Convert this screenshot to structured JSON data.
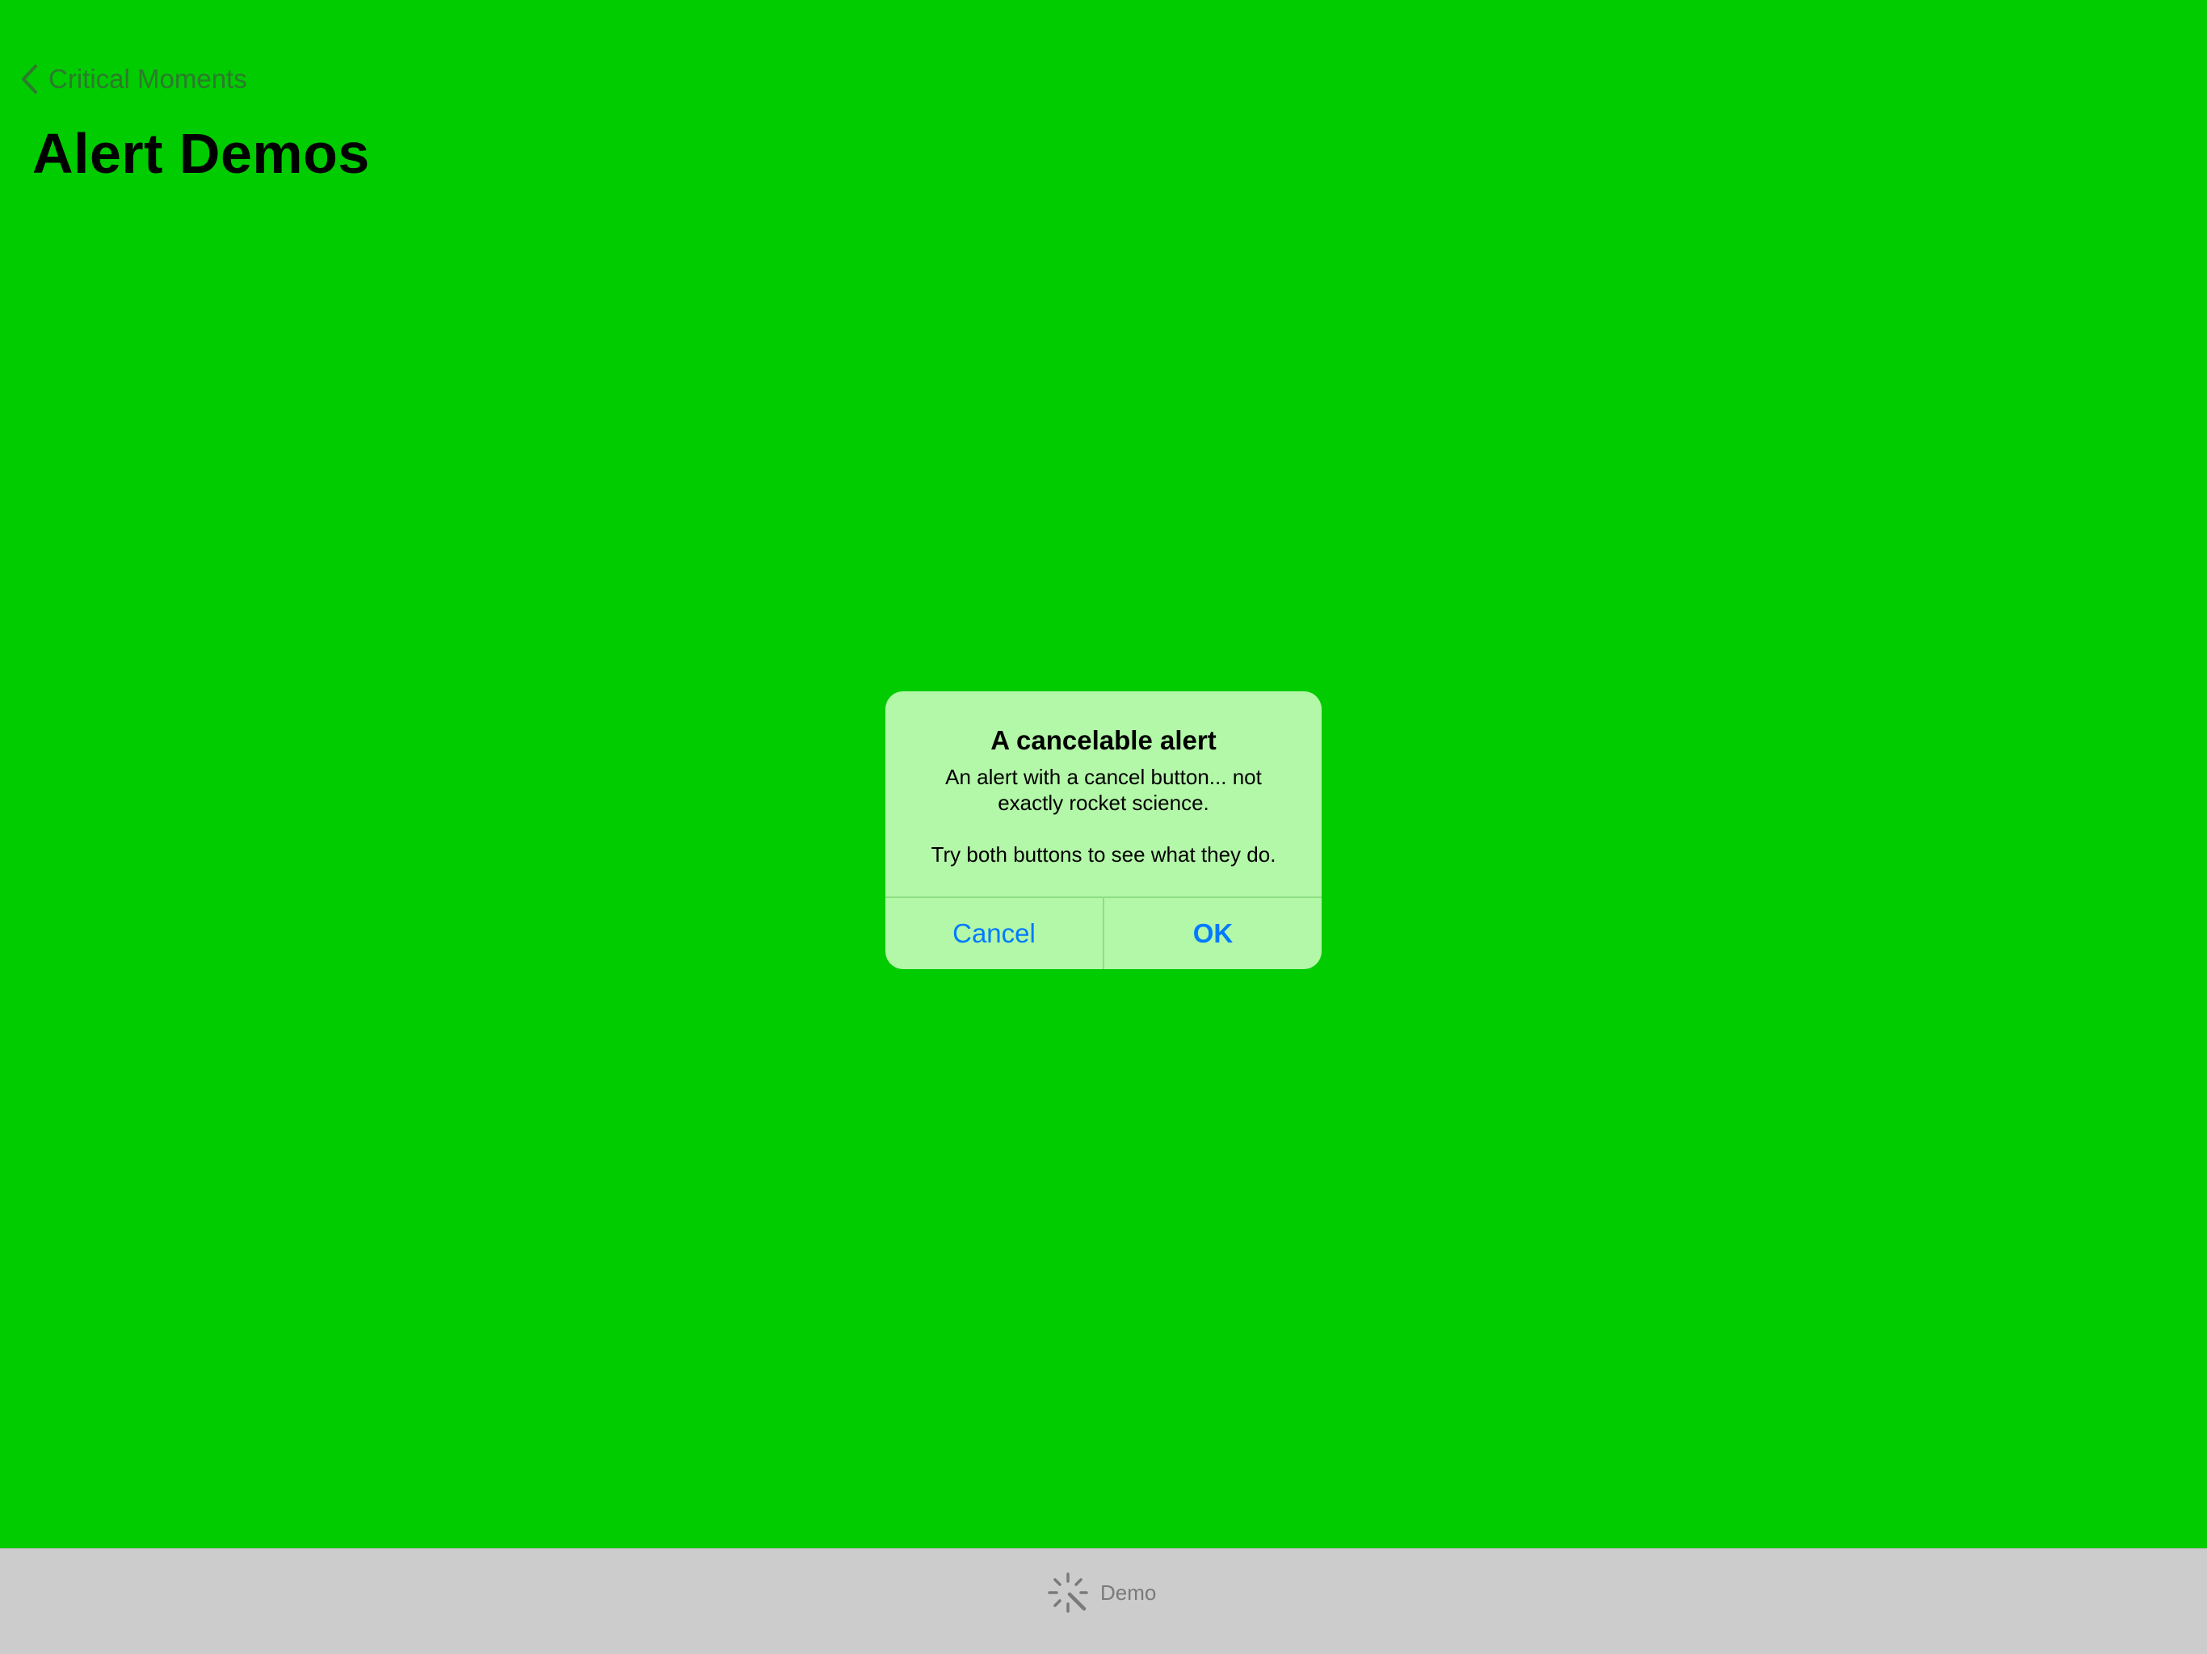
{
  "nav": {
    "back_label": "Critical Moments",
    "back_icon": "chevron-left-icon"
  },
  "page": {
    "title": "Alert Demos"
  },
  "alert": {
    "title": "A cancelable alert",
    "message": "An alert with a cancel button... not\nexactly rocket science.\n\nTry both buttons to see what they do.",
    "cancel_label": "Cancel",
    "ok_label": "OK"
  },
  "tabbar": {
    "items": [
      {
        "label": "Demo",
        "icon": "magic-wand-icon"
      }
    ]
  },
  "colors": {
    "background": "#00cc00",
    "alert_background": "#b3f7a8",
    "button_text": "#007aff",
    "tabbar_background": "#cccccc"
  }
}
